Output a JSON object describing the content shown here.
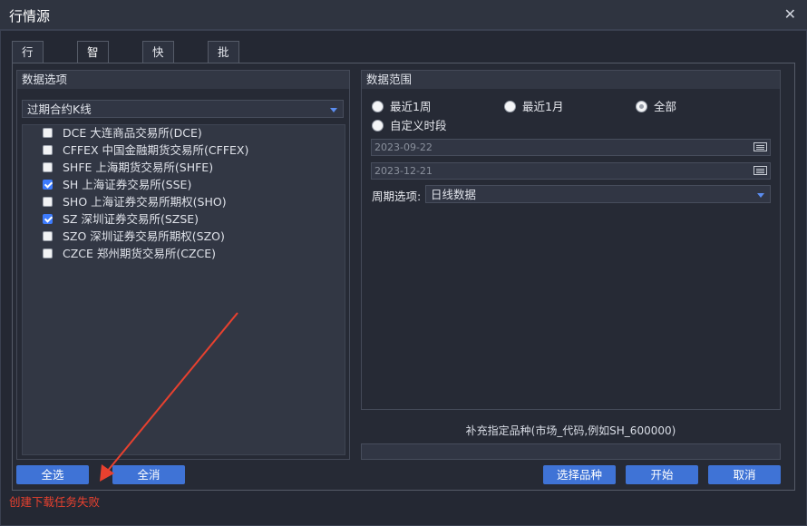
{
  "window": {
    "title": "行情源",
    "close_label": "✕"
  },
  "tabs": [
    {
      "label": "行情选择"
    },
    {
      "label": "智能下载"
    },
    {
      "label": "快速下载"
    },
    {
      "label": "批量下载"
    }
  ],
  "active_tab": "智能下载",
  "data_options": {
    "title": "数据选项",
    "contract_select": "过期合约K线",
    "items": [
      {
        "label": "DCE 大连商品交易所(DCE)",
        "checked": false
      },
      {
        "label": "CFFEX 中国金融期货交易所(CFFEX)",
        "checked": false
      },
      {
        "label": "SHFE 上海期货交易所(SHFE)",
        "checked": false
      },
      {
        "label": "SH 上海证券交易所(SSE)",
        "checked": true
      },
      {
        "label": "SHO 上海证券交易所期权(SHO)",
        "checked": false
      },
      {
        "label": "SZ 深圳证券交易所(SZSE)",
        "checked": true
      },
      {
        "label": "SZO 深圳证券交易所期权(SZO)",
        "checked": false
      },
      {
        "label": "CZCE 郑州期货交易所(CZCE)",
        "checked": false
      }
    ]
  },
  "data_range": {
    "title": "数据范围",
    "radios": [
      {
        "label": "最近1周",
        "selected": false
      },
      {
        "label": "最近1月",
        "selected": false
      },
      {
        "label": "全部",
        "selected": true
      },
      {
        "label": "自定义时段",
        "selected": false
      }
    ],
    "start_date": "2023-09-22",
    "end_date": "2023-12-21",
    "period_label": "周期选项:",
    "period_value": "日线数据"
  },
  "supplement": {
    "label": "补充指定品种(市场_代码,例如SH_600000)",
    "value": ""
  },
  "buttons": {
    "select_all": "全选",
    "clear_all": "全消",
    "choose_symbols": "选择品种",
    "start": "开始",
    "cancel": "取消"
  },
  "status": {
    "error": "创建下载任务失败"
  },
  "colors": {
    "accent": "#3f73d6",
    "error": "#e8412f",
    "background": "#242833"
  }
}
